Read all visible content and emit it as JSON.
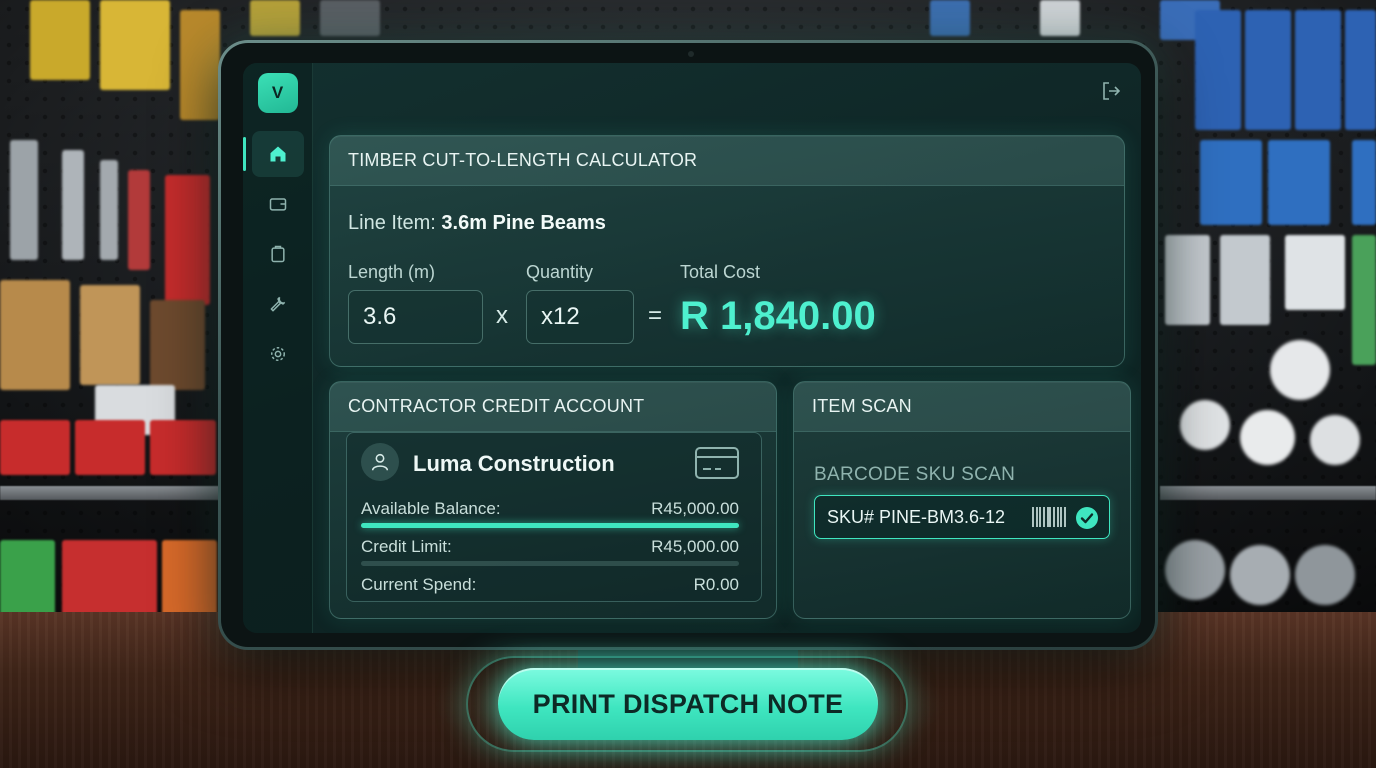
{
  "sidebar": {
    "logo": "V",
    "items": [
      {
        "icon": "home-icon",
        "active": true
      },
      {
        "icon": "wallet-icon",
        "active": false
      },
      {
        "icon": "clipboard-icon",
        "active": false
      },
      {
        "icon": "wrench-icon",
        "active": false
      },
      {
        "icon": "gear-icon",
        "active": false
      }
    ]
  },
  "header": {
    "logout_icon": "logout-icon"
  },
  "calculator": {
    "title": "TIMBER CUT-TO-LENGTH CALCULATOR",
    "line_item_label": "Line Item:",
    "line_item_value": "3.6m Pine Beams",
    "length_label": "Length (m)",
    "length_value": "3.6",
    "multiply_sign": "x",
    "quantity_label": "Quantity",
    "quantity_value": "x12",
    "equals_sign": "=",
    "total_label": "Total Cost",
    "total_value": "R 1,840.00"
  },
  "credit_account": {
    "title": "CONTRACTOR CREDIT ACCOUNT",
    "account_name": "Luma Construction",
    "available_label": "Available Balance:",
    "available_value": "R45,000.00",
    "available_fraction": 1.0,
    "limit_label": "Credit Limit:",
    "limit_value": "R45,000.00",
    "spend_label": "Current Spend:",
    "spend_value": "R0.00",
    "spend_fraction": 0.0
  },
  "item_scan": {
    "title": "ITEM SCAN",
    "field_label": "BARCODE SKU SCAN",
    "sku_value": "SKU# PINE-BM3.6-12",
    "status_icon": "check-icon"
  },
  "print_button": "PRINT DISPATCH NOTE",
  "colors": {
    "accent": "#3fe6c0",
    "total_text": "#4ef0cf",
    "logo_bg": "#2fcfa6"
  }
}
